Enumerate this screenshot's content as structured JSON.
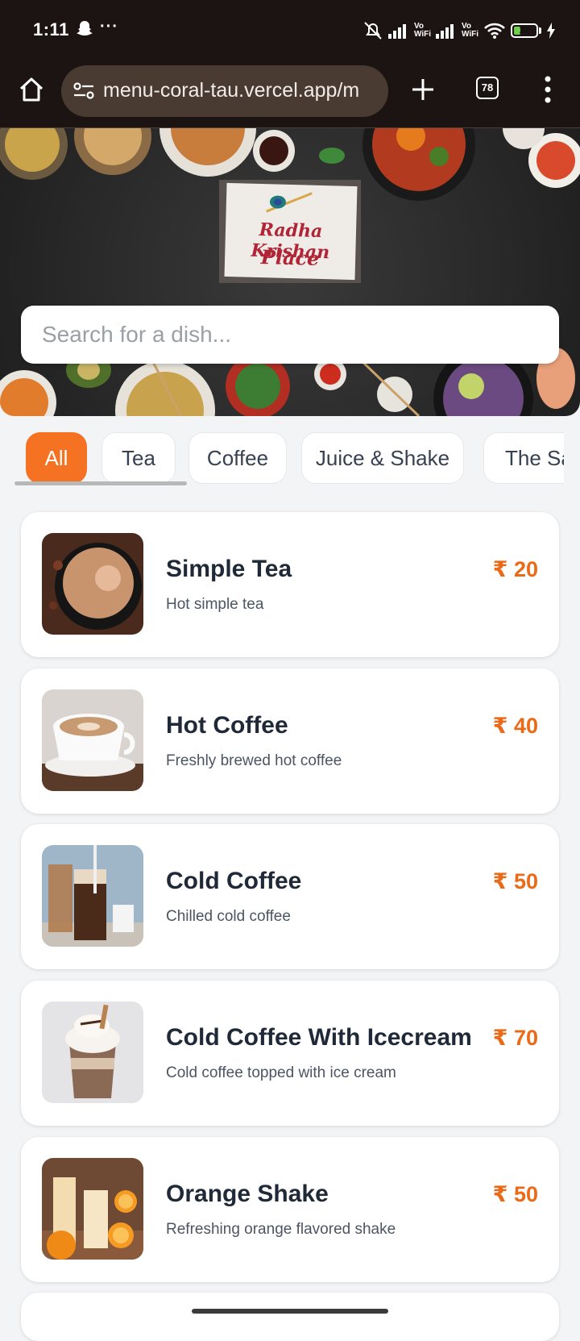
{
  "status_bar": {
    "time": "1:11",
    "more": "···",
    "volte1": "Vo\nWiFi",
    "volte2": "Vo\nWiFi",
    "battery": "27"
  },
  "browser": {
    "url": "menu-coral-tau.vercel.app/m",
    "tab_count": "78"
  },
  "hero": {
    "logo_line1": "Radha Krishan",
    "logo_line2": "Place",
    "search_placeholder": "Search for a dish..."
  },
  "categories": [
    "All",
    "Tea",
    "Coffee",
    "Juice & Shake",
    "The Sa"
  ],
  "active_category": "All",
  "menu_items": [
    {
      "name": "Simple Tea",
      "desc": "Hot simple tea",
      "price": "₹ 20"
    },
    {
      "name": "Hot Coffee",
      "desc": "Freshly brewed hot coffee",
      "price": "₹ 40"
    },
    {
      "name": "Cold Coffee",
      "desc": "Chilled cold coffee",
      "price": "₹ 50"
    },
    {
      "name": "Cold Coffee With Icecream",
      "desc": "Cold coffee topped with ice cream",
      "price": "₹ 70"
    },
    {
      "name": "Orange Shake",
      "desc": "Refreshing orange flavored shake",
      "price": "₹ 50"
    }
  ],
  "colors": {
    "accent": "#f57222",
    "price": "#ea6a17",
    "chrome": "#1c1412"
  }
}
